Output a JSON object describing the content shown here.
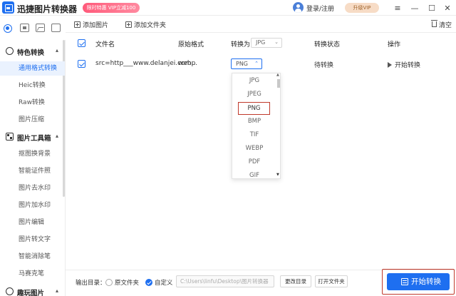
{
  "app": {
    "title": "迅捷图片转换器",
    "promo": "限时特惠 VIP立减100",
    "login": "登录/注册",
    "vip": "升级VIP",
    "window": {
      "minimize": "—",
      "restore": "☐",
      "close": "✕"
    }
  },
  "sidebar": {
    "sections": [
      {
        "label": "特色转换",
        "arrow": "▴",
        "items": [
          "通用格式转换",
          "Heic转换",
          "Raw转换",
          "图片压缩"
        ]
      },
      {
        "label": "图片工具箱",
        "arrow": "▴",
        "items": [
          "抠图换背景",
          "智能证件照",
          "图片去水印",
          "图片加水印",
          "图片编辑",
          "图片转文字",
          "智能消除笔",
          "马赛克笔"
        ]
      },
      {
        "label": "趣玩图片",
        "arrow": "▴",
        "items": []
      }
    ],
    "active_item": "通用格式转换"
  },
  "toolbar": {
    "add_image": "添加图片",
    "add_folder": "添加文件夹",
    "clear": "清空"
  },
  "table": {
    "headers": {
      "filename": "文件名",
      "original_format": "原始格式",
      "convert_to": "转换为",
      "convert_to_value": "JPG",
      "status": "转换状态",
      "action": "操作"
    },
    "rows": [
      {
        "filename": "src=http___www.delanjei.com...",
        "original_format": "webp",
        "target_format": "PNG",
        "status": "待转换",
        "action": "开始转换"
      }
    ]
  },
  "dropdown": {
    "options": [
      "JPG",
      "JPEG",
      "PNG",
      "BMP",
      "TIF",
      "WEBP",
      "PDF",
      "GIF"
    ],
    "selected": "PNG"
  },
  "footer": {
    "output_label": "输出目录：",
    "option_original": "原文件夹",
    "option_custom": "自定义",
    "path": "C:\\Users\\linfu\\Desktop\\图片转换器",
    "change_dir": "更改目录",
    "open_folder": "打开文件夹",
    "start": "开始转换"
  },
  "colors": {
    "accent": "#1e6ff0",
    "highlight_border": "#c0392b",
    "active_bg": "#eaf2fe"
  }
}
